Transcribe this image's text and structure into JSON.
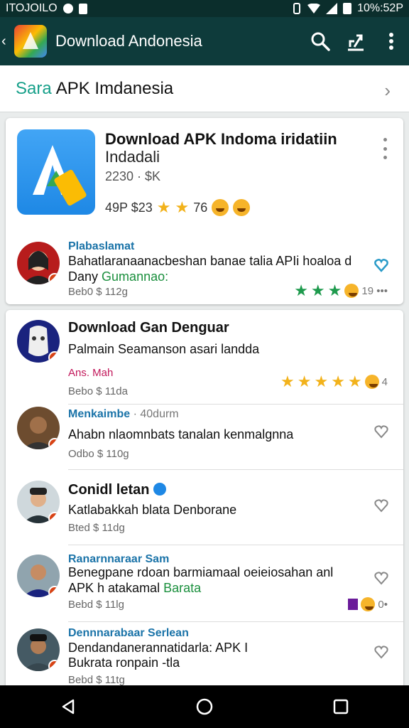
{
  "status": {
    "left_text": "ITOJOILO",
    "right_text": "10%:52P"
  },
  "appbar": {
    "title": "Download Andonesia"
  },
  "header": {
    "prefix": "Sara",
    "title": "APK Imdanesia"
  },
  "app": {
    "title": "Download APK Indoma iridatiin",
    "subtitle": "Indadali",
    "meta": "2230 · $K",
    "rating_text": "49P $23",
    "rating_count": "76"
  },
  "reviews": [
    {
      "name": "Plabaslamat",
      "text": "Bahatlaranaanacbeshan banae talia APIi hoaloa d Dany",
      "tag": "Gumannao:",
      "date": "Beb0 $ 112g",
      "extra": "19 •••"
    },
    {
      "name": "Download Gan Denguar",
      "text": "Palmain Seamanson asari landda",
      "tag": "Ans. Mah",
      "date": "Bebo $ 11da",
      "extra": "4"
    },
    {
      "name": "Menkaimbe",
      "meta": "· 40durm",
      "text": "Ahabn nlaomnbats tanalan kenmalgnna",
      "date": "Odbo $ 110g"
    },
    {
      "name": "Conidl letan",
      "text": "Katlabakkah blata Denborane",
      "date": "Bted $ 11dg"
    },
    {
      "name": "Ranarnnaraar Sam",
      "text": "Benegpane rdoan barmiamaal oeieiosahan anl APK h atakamal",
      "tag": "Barata",
      "date": "Bebd $ 11lg",
      "extra": "0•"
    },
    {
      "name": "Dennnarabaar Serlean",
      "text": "Dendandanerannatidarla: APK I",
      "tag": "Bukrata ronpain -tla",
      "date": "Bebd $ 11tg"
    }
  ],
  "nav": {
    "back": "back-button",
    "home": "home-button",
    "recents": "recents-button"
  }
}
